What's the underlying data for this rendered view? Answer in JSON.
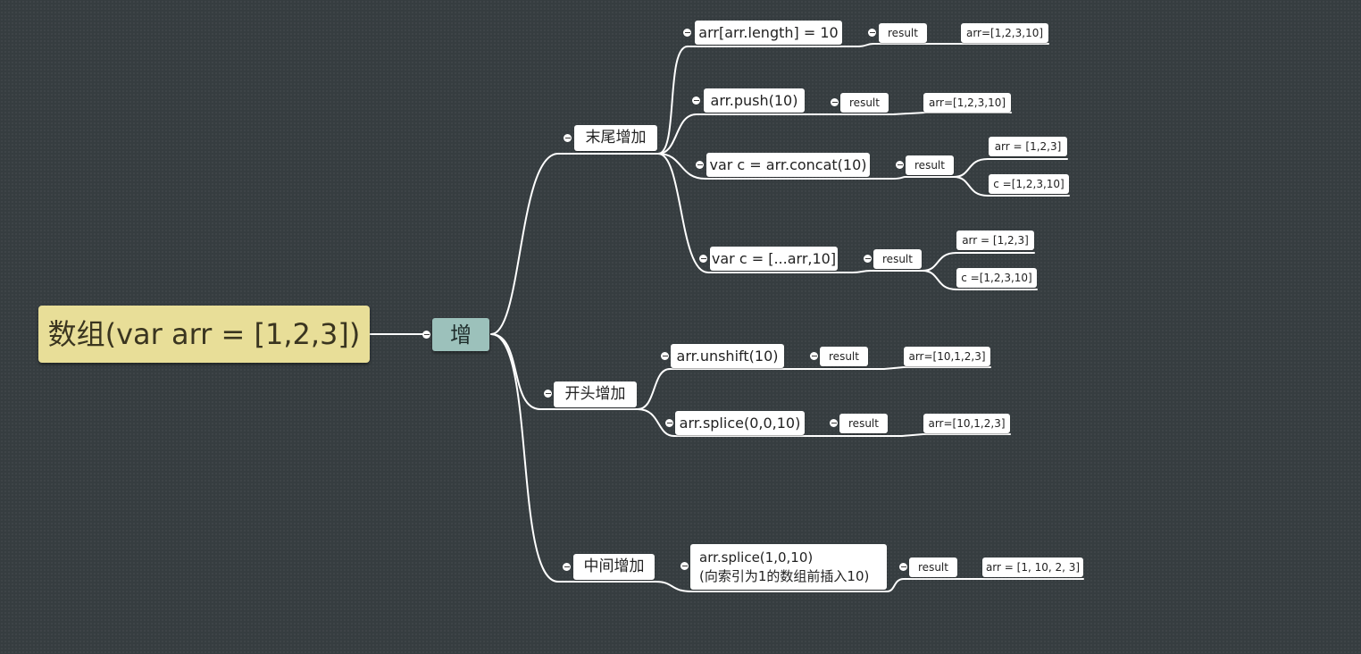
{
  "root": {
    "label": "数组(var arr = [1,2,3])"
  },
  "main": {
    "label": "增"
  },
  "branches": {
    "end": {
      "label": "末尾增加",
      "m1": {
        "code": "arr[arr.length] = 10",
        "result": "result",
        "value": "arr=[1,2,3,10]"
      },
      "m2": {
        "code": "arr.push(10)",
        "result": "result",
        "value": "arr=[1,2,3,10]"
      },
      "m3": {
        "code": "var c = arr.concat(10)",
        "result": "result",
        "value_arr": "arr = [1,2,3]",
        "value_c": "c =[1,2,3,10]"
      },
      "m4": {
        "code": "var c = [...arr,10]",
        "result": "result",
        "value_arr": "arr = [1,2,3]",
        "value_c": "c =[1,2,3,10]"
      }
    },
    "start": {
      "label": "开头增加",
      "m1": {
        "code": "arr.unshift(10)",
        "result": "result",
        "value": "arr=[10,1,2,3]"
      },
      "m2": {
        "code": "arr.splice(0,0,10)",
        "result": "result",
        "value": "arr=[10,1,2,3]"
      }
    },
    "middle": {
      "label": "中间增加",
      "m1": {
        "code_line1": "arr.splice(1,0,10)",
        "code_line2": "(向索引为1的数组前插入10)",
        "result": "result",
        "value": "arr = [1, 10, 2, 3]"
      }
    }
  }
}
